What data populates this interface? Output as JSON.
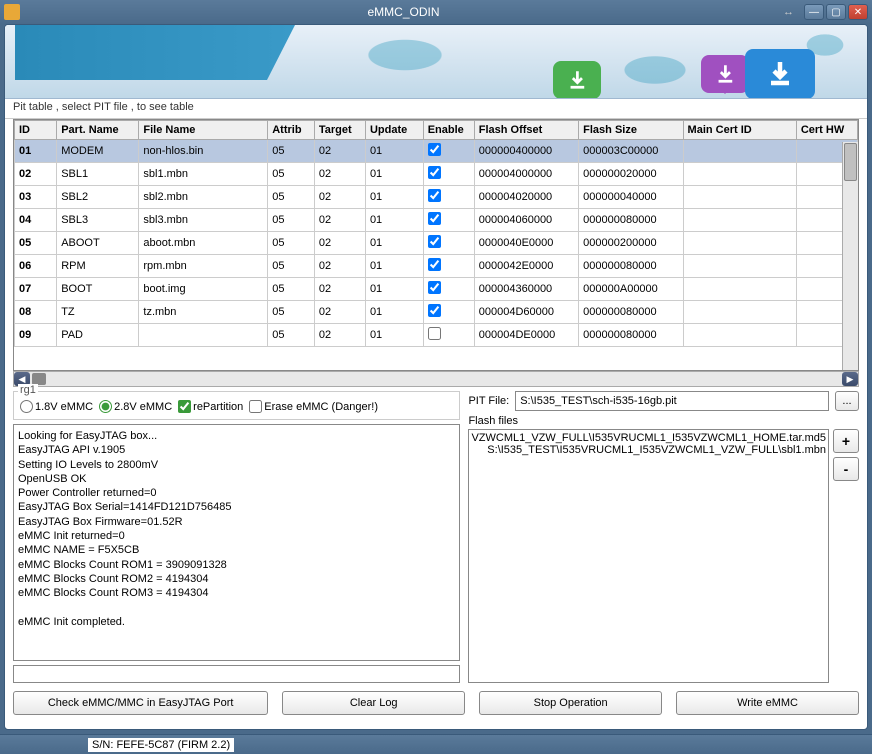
{
  "title": "eMMC_ODIN",
  "tab_label": "Pit table , select PIT file , to see table",
  "columns": [
    "ID",
    "Part. Name",
    "File Name",
    "Attrib",
    "Target",
    "Update",
    "Enable",
    "Flash Offset",
    "Flash Size",
    "Main Cert ID",
    "Cert HW"
  ],
  "rows": [
    {
      "id": "01",
      "part": "MODEM",
      "file": "non-hlos.bin",
      "attrib": "05",
      "target": "02",
      "update": "01",
      "enable": true,
      "offset": "000000400000",
      "size": "000003C00000",
      "cert": "",
      "hw": "",
      "sel": true
    },
    {
      "id": "02",
      "part": "SBL1",
      "file": "sbl1.mbn",
      "attrib": "05",
      "target": "02",
      "update": "01",
      "enable": true,
      "offset": "000004000000",
      "size": "000000020000",
      "cert": "",
      "hw": ""
    },
    {
      "id": "03",
      "part": "SBL2",
      "file": "sbl2.mbn",
      "attrib": "05",
      "target": "02",
      "update": "01",
      "enable": true,
      "offset": "000004020000",
      "size": "000000040000",
      "cert": "",
      "hw": ""
    },
    {
      "id": "04",
      "part": "SBL3",
      "file": "sbl3.mbn",
      "attrib": "05",
      "target": "02",
      "update": "01",
      "enable": true,
      "offset": "000004060000",
      "size": "000000080000",
      "cert": "",
      "hw": ""
    },
    {
      "id": "05",
      "part": "ABOOT",
      "file": "aboot.mbn",
      "attrib": "05",
      "target": "02",
      "update": "01",
      "enable": true,
      "offset": "0000040E0000",
      "size": "000000200000",
      "cert": "",
      "hw": ""
    },
    {
      "id": "06",
      "part": "RPM",
      "file": "rpm.mbn",
      "attrib": "05",
      "target": "02",
      "update": "01",
      "enable": true,
      "offset": "0000042E0000",
      "size": "000000080000",
      "cert": "",
      "hw": ""
    },
    {
      "id": "07",
      "part": "BOOT",
      "file": "boot.img",
      "attrib": "05",
      "target": "02",
      "update": "01",
      "enable": true,
      "offset": "000004360000",
      "size": "000000A00000",
      "cert": "",
      "hw": ""
    },
    {
      "id": "08",
      "part": "TZ",
      "file": "tz.mbn",
      "attrib": "05",
      "target": "02",
      "update": "01",
      "enable": true,
      "offset": "000004D60000",
      "size": "000000080000",
      "cert": "",
      "hw": ""
    },
    {
      "id": "09",
      "part": "PAD",
      "file": "",
      "attrib": "05",
      "target": "02",
      "update": "01",
      "enable": false,
      "offset": "000004DE0000",
      "size": "000000080000",
      "cert": "",
      "hw": ""
    }
  ],
  "rg1": {
    "label": "rg1",
    "r1": "1.8V eMMC",
    "r2": "2.8V eMMC",
    "repart": "rePartition",
    "erase": "Erase eMMC (Danger!)"
  },
  "log": "Looking for EasyJTAG box...\nEasyJTAG API v.1905\nSetting IO Levels to 2800mV\nOpenUSB OK\nPower Controller returned=0\nEasyJTAG Box Serial=1414FD121D756485\nEasyJTAG Box Firmware=01.52R\neMMC Init returned=0\neMMC NAME = F5X5CB\neMMC Blocks Count ROM1 = 3909091328\neMMC Blocks Count ROM2 = 4194304\neMMC Blocks Count ROM3 = 4194304\n\neMMC Init completed.",
  "pit": {
    "label": "PIT File:",
    "value": "S:\\I535_TEST\\sch-i535-16gb.pit",
    "browse": "..."
  },
  "flash": {
    "label": "Flash files",
    "items": [
      "VZWCML1_VZW_FULL\\I535VRUCML1_I535VZWCML1_HOME.tar.md5",
      "S:\\I535_TEST\\I535VRUCML1_I535VZWCML1_VZW_FULL\\sbl1.mbn"
    ],
    "add": "+",
    "remove": "-"
  },
  "buttons": {
    "check": "Check eMMC/MMC in EasyJTAG Port",
    "clear": "Clear Log",
    "stop": "Stop Operation",
    "write": "Write eMMC"
  },
  "status": "S/N: FEFE-5C87 (FIRM 2.2)"
}
